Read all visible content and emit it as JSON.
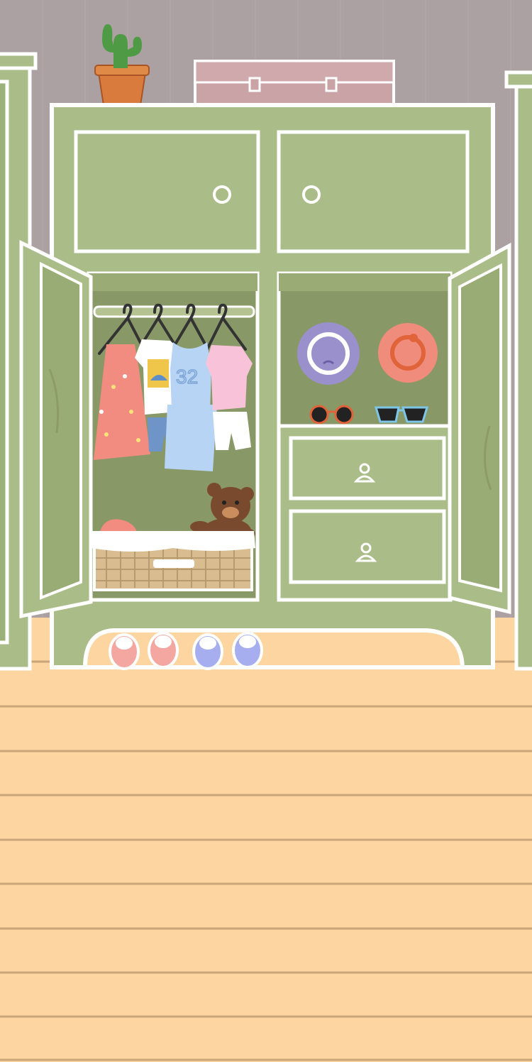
{
  "scene": "kids-wardrobe-room",
  "colors": {
    "wall": "#aba1a3",
    "wall_stripe": "#b8a9a6",
    "floor": "#fdd5a0",
    "floor_line": "#c9a57a",
    "wardrobe": "#aabd88",
    "wardrobe_dark": "#8c9c66",
    "interior": "#889866",
    "outline": "#ffffff",
    "suitcase": "#c9a3a6",
    "pot": "#d97b3d",
    "cactus": "#4f9a45",
    "hanger": "#333333",
    "dress": "#f28b80",
    "tshirt": "#ffffff",
    "jersey": "#b8d4f5",
    "pink_top": "#f8c3d8",
    "shorts_denim": "#6e94c8",
    "hat_purple": "#9a90cc",
    "hat_coral": "#f08c7c",
    "glasses_orange": "#e0633a",
    "glasses_blue": "#7ec6e8",
    "basket": "#d9bd91",
    "teddy": "#7a4a2e",
    "slipper_pink": "#f4a7a0",
    "slipper_blue": "#a7aef0"
  },
  "items": {
    "jersey_number": "32",
    "icons": [
      "cactus-icon",
      "suitcase-icon",
      "hanger-icon",
      "hat-icon",
      "sunglasses-icon",
      "teddy-bear-icon",
      "basket-icon",
      "slipper-icon",
      "drawer-handle-icon",
      "door-knob-icon"
    ]
  }
}
